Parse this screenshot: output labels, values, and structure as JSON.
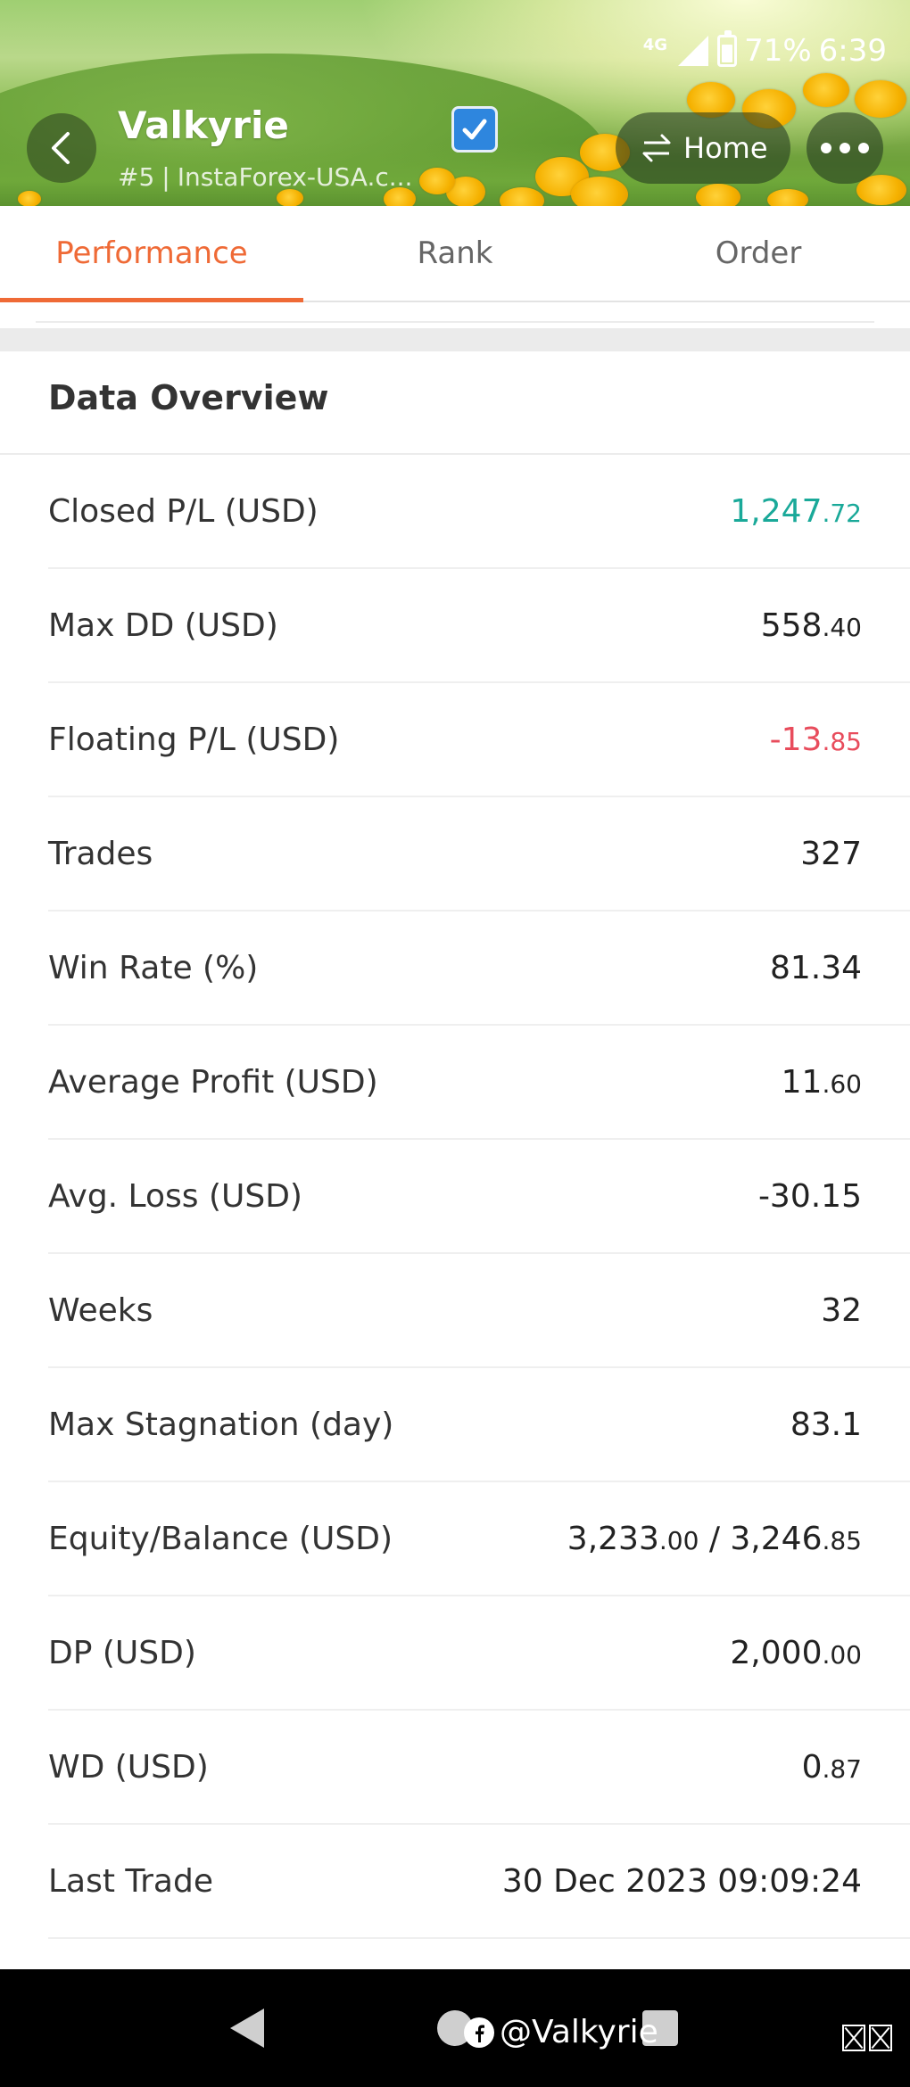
{
  "status_bar": {
    "network": "4G",
    "battery": "71%",
    "time": "6:39"
  },
  "header": {
    "trader_name": "Valkyrie",
    "rank": "#5",
    "broker": "InstaForex-USA.c...",
    "home_label": "Home"
  },
  "tabs": [
    {
      "label": "Performance",
      "active": true
    },
    {
      "label": "Rank",
      "active": false
    },
    {
      "label": "Order",
      "active": false
    }
  ],
  "overview": {
    "title": "Data Overview",
    "rows": [
      {
        "label": "Closed P/L (USD)",
        "int": "1,247",
        "frac": ".72",
        "tone": "pos"
      },
      {
        "label": "Max DD (USD)",
        "int": "558",
        "frac": ".40",
        "tone": ""
      },
      {
        "label": "Floating P/L (USD)",
        "int": "-13",
        "frac": ".85",
        "tone": "neg"
      },
      {
        "label": "Trades",
        "int": "327",
        "frac": "",
        "tone": ""
      },
      {
        "label": "Win Rate (%)",
        "int": "81.34",
        "frac": "",
        "tone": ""
      },
      {
        "label": "Average Profit (USD)",
        "int": "11",
        "frac": ".60",
        "tone": ""
      },
      {
        "label": "Avg. Loss (USD)",
        "int": "-30.15",
        "frac": "",
        "tone": ""
      },
      {
        "label": "Weeks",
        "int": "32",
        "frac": "",
        "tone": ""
      },
      {
        "label": "Max Stagnation (day)",
        "int": "83.1",
        "frac": "",
        "tone": ""
      },
      {
        "label": "Equity/Balance (USD)",
        "int": "3,233",
        "frac": ".00",
        "int2": " / 3,246",
        "frac2": ".85",
        "tone": ""
      },
      {
        "label": "DP (USD)",
        "int": "2,000",
        "frac": ".00",
        "tone": ""
      },
      {
        "label": "WD (USD)",
        "int": "0",
        "frac": ".87",
        "tone": ""
      },
      {
        "label": "Last Trade",
        "int": "30 Dec 2023 09:09:24",
        "frac": "",
        "tone": ""
      }
    ]
  },
  "watermark": "@Valkyrie",
  "colors": {
    "accent": "#ef6a36",
    "positive": "#1aa999",
    "negative": "#e84c5c"
  },
  "icons": {
    "back": "chevron-left-icon",
    "verified": "check-box-icon",
    "home": "swap-arrows-icon",
    "more": "more-dots-icon"
  }
}
